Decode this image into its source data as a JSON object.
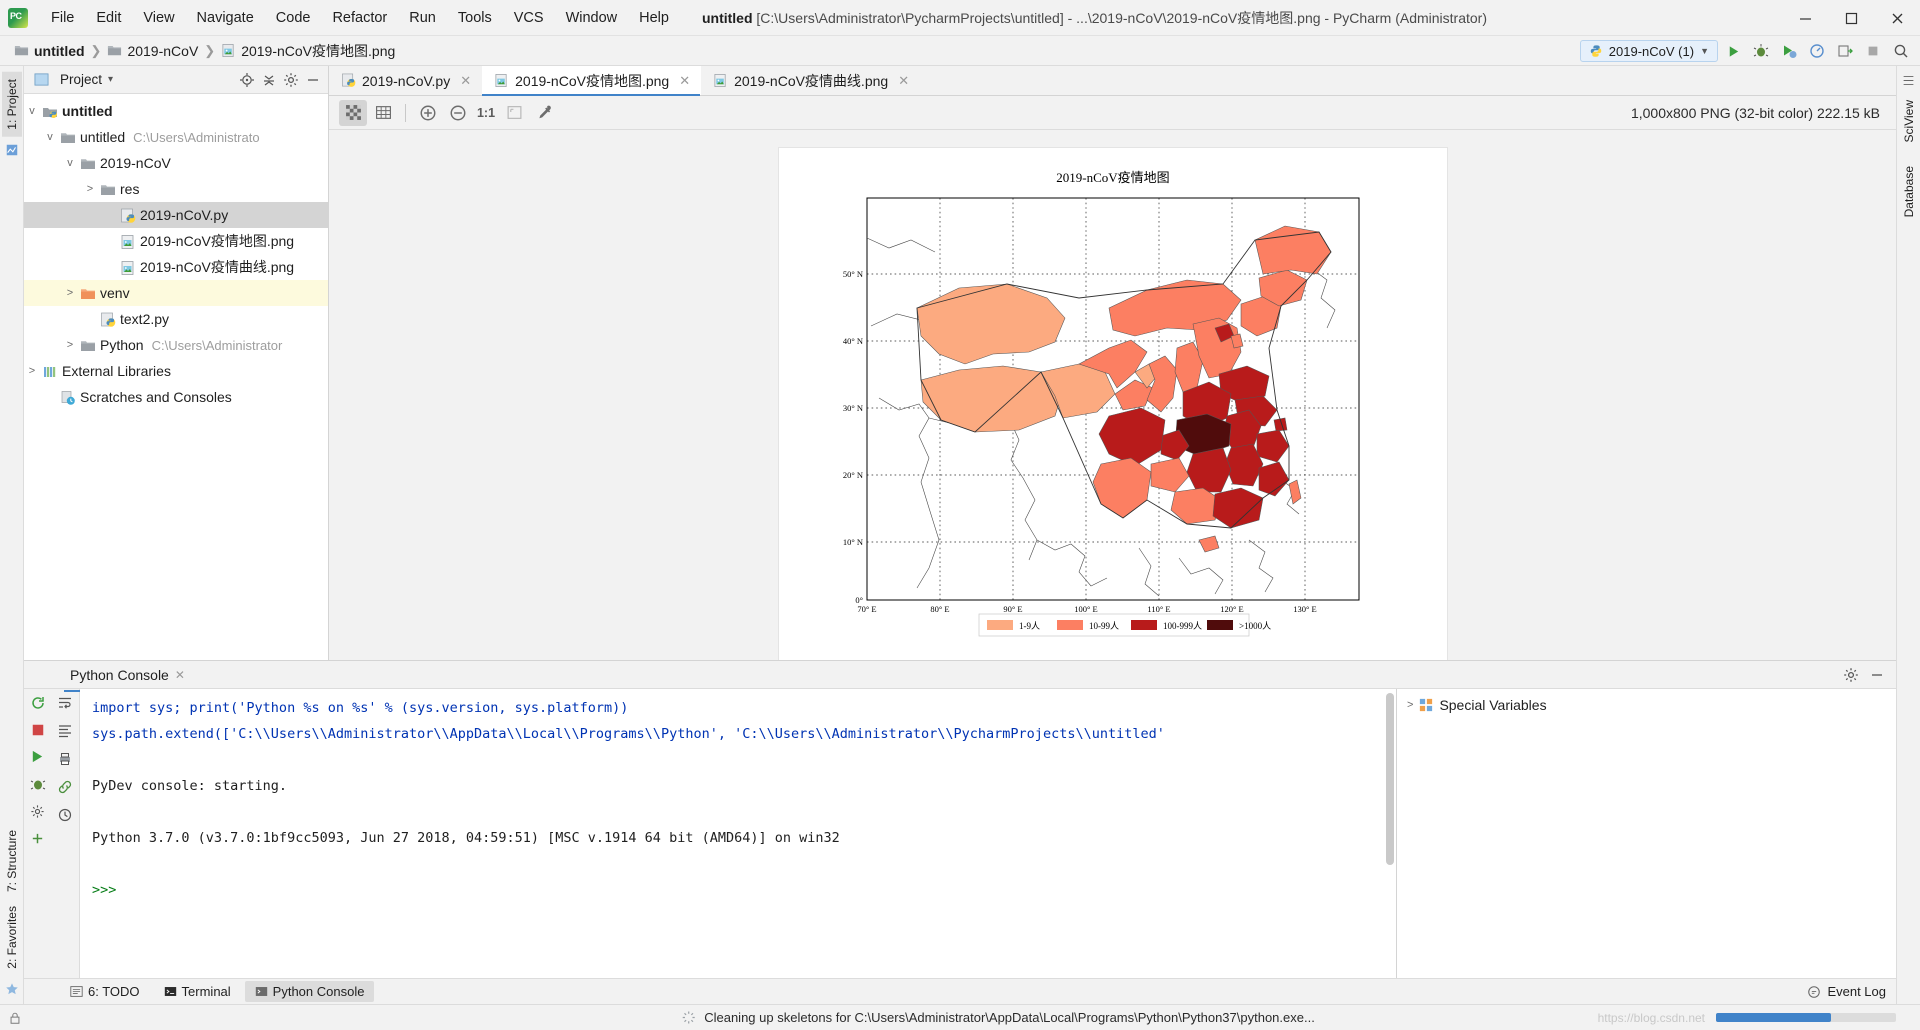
{
  "window": {
    "app_title_bold": "untitled",
    "app_title_rest": "[C:\\Users\\Administrator\\PycharmProjects\\untitled] - ...\\2019-nCoV\\2019-nCoV疫情地图.png - PyCharm (Administrator)",
    "minimize": "—",
    "maximize": "▢",
    "close": "✕",
    "logo": "pycharm-logo"
  },
  "menu": [
    {
      "label": "File"
    },
    {
      "label": "Edit"
    },
    {
      "label": "View"
    },
    {
      "label": "Navigate"
    },
    {
      "label": "Code"
    },
    {
      "label": "Refactor"
    },
    {
      "label": "Run"
    },
    {
      "label": "Tools"
    },
    {
      "label": "VCS"
    },
    {
      "label": "Window"
    },
    {
      "label": "Help"
    }
  ],
  "breadcrumb": [
    {
      "label": "untitled",
      "icon": "folder-icon",
      "bold": true
    },
    {
      "label": "2019-nCoV",
      "icon": "folder-icon",
      "bold": false
    },
    {
      "label": "2019-nCoV疫情地图.png",
      "icon": "image-file-icon",
      "bold": false
    }
  ],
  "navbar_right": {
    "run_config": "2019-nCoV (1)",
    "run_button": "run-icon",
    "debug_button": "debug-icon",
    "coverage_button": "run-coverage-icon",
    "profile_button": "profile-icon",
    "attach_button": "attach-icon",
    "stop_button": "stop-icon",
    "search_button": "search-icon"
  },
  "left_strip": {
    "project_tab": "1: Project",
    "structure_tab": "7: Structure",
    "favorites_tab": "2: Favorites"
  },
  "right_strip": {
    "sciview_tab": "SciView",
    "database_tab": "Database"
  },
  "project_panel": {
    "title": "Project",
    "dropdown": "▾",
    "locate_icon": "locate-icon",
    "collapse_icon": "collapse-all-icon",
    "settings_icon": "gear-icon",
    "hide_icon": "hide-icon",
    "tree": [
      {
        "label": "untitled",
        "path": "",
        "indent": 0,
        "arrow": "v",
        "icon": "project-icon",
        "bold": true,
        "state": "normal"
      },
      {
        "label": "untitled",
        "path": "C:\\Users\\Administrato",
        "indent": 1,
        "arrow": "v",
        "icon": "folder-icon",
        "bold": false,
        "state": "normal"
      },
      {
        "label": "2019-nCoV",
        "path": "",
        "indent": 2,
        "arrow": "v",
        "icon": "folder-icon",
        "bold": false,
        "state": "normal"
      },
      {
        "label": "res",
        "path": "",
        "indent": 3,
        "arrow": ">",
        "icon": "folder-icon",
        "bold": false,
        "state": "normal"
      },
      {
        "label": "2019-nCoV.py",
        "path": "",
        "indent": 4,
        "arrow": "",
        "icon": "python-file-icon",
        "bold": false,
        "state": "selected"
      },
      {
        "label": "2019-nCoV疫情地图.png",
        "path": "",
        "indent": 4,
        "arrow": "",
        "icon": "image-file-icon",
        "bold": false,
        "state": "normal"
      },
      {
        "label": "2019-nCoV疫情曲线.png",
        "path": "",
        "indent": 4,
        "arrow": "",
        "icon": "image-file-icon",
        "bold": false,
        "state": "normal"
      },
      {
        "label": "venv",
        "path": "",
        "indent": 2,
        "arrow": ">",
        "icon": "excluded-folder-icon",
        "bold": false,
        "state": "venv"
      },
      {
        "label": "text2.py",
        "path": "",
        "indent": 3,
        "arrow": "",
        "icon": "python-file-icon",
        "bold": false,
        "state": "normal"
      },
      {
        "label": "Python",
        "path": "C:\\Users\\Administrator",
        "indent": 2,
        "arrow": ">",
        "icon": "folder-icon",
        "bold": false,
        "state": "normal"
      },
      {
        "label": "External Libraries",
        "path": "",
        "indent": 0,
        "arrow": ">",
        "icon": "libraries-icon",
        "bold": false,
        "state": "normal"
      },
      {
        "label": "Scratches and Consoles",
        "path": "",
        "indent": 0,
        "arrow": "",
        "icon": "scratches-icon",
        "bold": false,
        "state": "normal"
      }
    ]
  },
  "editor_tabs": [
    {
      "label": "2019-nCoV.py",
      "icon": "python-file-icon",
      "active": false,
      "close": "✕"
    },
    {
      "label": "2019-nCoV疫情地图.png",
      "icon": "image-file-icon",
      "active": true,
      "close": "✕"
    },
    {
      "label": "2019-nCoV疫情曲线.png",
      "icon": "image-file-icon",
      "active": false,
      "close": "✕"
    }
  ],
  "image_toolbar": {
    "toggle_transparency_chessboard": "chessboard-icon",
    "toggle_grid": "grid-icon",
    "zoom_in": "zoom-in-icon",
    "zoom_out": "zoom-out-icon",
    "actual_size": "1:1",
    "fit_to_window": "fit-window-icon",
    "color_picker": "eyedropper-icon",
    "info": "1,000x800 PNG (32-bit color) 222.15 kB"
  },
  "chart_data": {
    "type": "heatmap",
    "title": "2019-nCoV疫情地图",
    "xlabel": "",
    "ylabel": "",
    "x_ticks": [
      "70° E",
      "80° E",
      "90° E",
      "100° E",
      "110° E",
      "120° E",
      "130° E"
    ],
    "y_ticks": [
      "0°",
      "10° N",
      "20° N",
      "30° N",
      "40° N",
      "50° N"
    ],
    "xlim": [
      70,
      137
    ],
    "ylim": [
      0,
      56
    ],
    "grid": true,
    "legend_position": "bottom",
    "legend": [
      {
        "label": "1-9人",
        "color": "#fcaa80"
      },
      {
        "label": "10-99人",
        "color": "#fc7f62"
      },
      {
        "label": "100-999人",
        "color": "#b81b1b"
      },
      {
        "label": ">1000人",
        "color": "#500c0c"
      }
    ],
    "regions": [
      {
        "name": "湖北",
        "bin": ">1000人",
        "color": "#500c0c"
      },
      {
        "name": "浙江",
        "bin": "100-999人",
        "color": "#b81b1b"
      },
      {
        "name": "广东",
        "bin": "100-999人",
        "color": "#b81b1b"
      },
      {
        "name": "河南",
        "bin": "100-999人",
        "color": "#b81b1b"
      },
      {
        "name": "湖南",
        "bin": "100-999人",
        "color": "#b81b1b"
      },
      {
        "name": "安徽",
        "bin": "100-999人",
        "color": "#b81b1b"
      },
      {
        "name": "江西",
        "bin": "100-999人",
        "color": "#b81b1b"
      },
      {
        "name": "重庆",
        "bin": "100-999人",
        "color": "#b81b1b"
      },
      {
        "name": "江苏",
        "bin": "100-999人",
        "color": "#b81b1b"
      },
      {
        "name": "四川",
        "bin": "100-999人",
        "color": "#b81b1b"
      },
      {
        "name": "山东",
        "bin": "100-999人",
        "color": "#b81b1b"
      },
      {
        "name": "北京",
        "bin": "100-999人",
        "color": "#b81b1b"
      },
      {
        "name": "上海",
        "bin": "100-999人",
        "color": "#b81b1b"
      },
      {
        "name": "福建",
        "bin": "100-999人",
        "color": "#b81b1b"
      },
      {
        "name": "黑龙江",
        "bin": "10-99人",
        "color": "#fc7f62"
      },
      {
        "name": "陕西",
        "bin": "10-99人",
        "color": "#fc7f62"
      },
      {
        "name": "河北",
        "bin": "10-99人",
        "color": "#fc7f62"
      },
      {
        "name": "广西",
        "bin": "10-99人",
        "color": "#fc7f62"
      },
      {
        "name": "云南",
        "bin": "10-99人",
        "color": "#fc7f62"
      },
      {
        "name": "辽宁",
        "bin": "10-99人",
        "color": "#fc7f62"
      },
      {
        "name": "海南",
        "bin": "10-99人",
        "color": "#fc7f62"
      },
      {
        "name": "山西",
        "bin": "10-99人",
        "color": "#fc7f62"
      },
      {
        "name": "甘肃",
        "bin": "10-99人",
        "color": "#fc7f62"
      },
      {
        "name": "贵州",
        "bin": "10-99人",
        "color": "#fc7f62"
      },
      {
        "name": "天津",
        "bin": "10-99人",
        "color": "#fc7f62"
      },
      {
        "name": "新疆",
        "bin": "1-9人",
        "color": "#fcaa80"
      },
      {
        "name": "内蒙古",
        "bin": "10-99人",
        "color": "#fc7f62"
      },
      {
        "name": "宁夏",
        "bin": "1-9人",
        "color": "#fcaa80"
      },
      {
        "name": "青海",
        "bin": "1-9人",
        "color": "#fcaa80"
      },
      {
        "name": "西藏",
        "bin": "1-9人",
        "color": "#fcaa80"
      },
      {
        "name": "吉林",
        "bin": "10-99人",
        "color": "#fc7f62"
      }
    ]
  },
  "console": {
    "tab_label": "Python Console",
    "tab_close": "✕",
    "settings_icon": "gear-icon",
    "hide_icon": "hide-icon",
    "rerun_icon": "rerun-icon",
    "stop_icon": "stop-icon",
    "execute_icon": "execute-icon",
    "print_icon": "print-icon",
    "attach_icon": "attach-debugger-icon",
    "settings2_icon": "settings-icon",
    "add_icon": "add-icon",
    "softwrap_icon": "soft-wrap-icon",
    "scroll_end_icon": "scroll-to-end-icon",
    "link_icon": "link-icon",
    "history_icon": "history-icon",
    "lines": [
      {
        "text": "import sys; print('Python %s on %s' % (sys.version, sys.platform))",
        "style": "blue"
      },
      {
        "text": "sys.path.extend(['C:\\\\Users\\\\Administrator\\\\AppData\\\\Local\\\\Programs\\\\Python', 'C:\\\\Users\\\\Administrator\\\\PycharmProjects\\\\untitled'",
        "style": "blue"
      },
      {
        "text": "",
        "style": "dark"
      },
      {
        "text": "PyDev console: starting.",
        "style": "dark"
      },
      {
        "text": "",
        "style": "dark"
      },
      {
        "text": "Python 3.7.0 (v3.7.0:1bf9cc5093, Jun 27 2018, 04:59:51) [MSC v.1914 64 bit (AMD64)] on win32",
        "style": "dark"
      },
      {
        "text": "",
        "style": "dark"
      },
      {
        "text": ">>>",
        "style": "green"
      }
    ],
    "variables_title": "Special Variables",
    "variables_arrow": ">"
  },
  "bottom_bar": {
    "tabs": [
      {
        "label": "6: TODO",
        "icon": "todo-icon",
        "active": false
      },
      {
        "label": "Terminal",
        "icon": "terminal-icon",
        "active": false
      },
      {
        "label": "Python Console",
        "icon": "python-console-icon",
        "active": true
      }
    ],
    "event_log": "Event Log",
    "event_log_icon": "balloon-icon"
  },
  "status_bar": {
    "message": "Cleaning up skeletons for C:\\Users\\Administrator\\AppData\\Local\\Programs\\Python\\Python37\\python.exe...",
    "spinner": "spinner-icon",
    "lock_icon": "lock-icon",
    "progress_percent": 64
  }
}
